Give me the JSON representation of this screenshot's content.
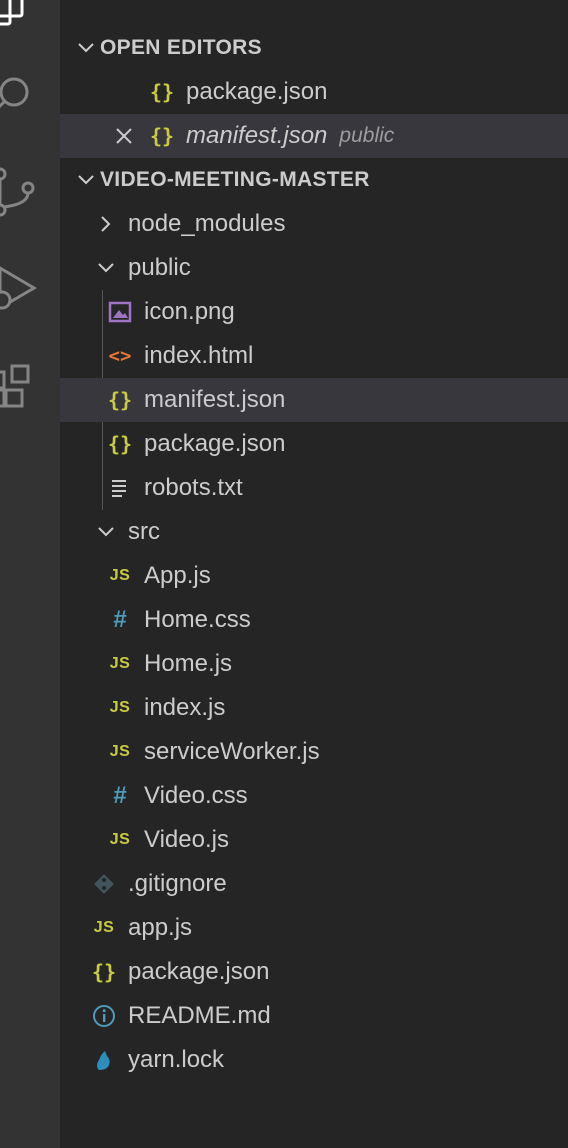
{
  "open_editors": {
    "header": "OPEN EDITORS",
    "items": [
      {
        "name": "package.json",
        "icon": "json-icon"
      },
      {
        "name": "manifest.json",
        "description": "public",
        "icon": "json-icon",
        "active": true
      }
    ]
  },
  "project": {
    "header": "VIDEO-MEETING-MASTER",
    "node_modules": "node_modules",
    "public": {
      "name": "public",
      "files": [
        "icon.png",
        "index.html",
        "manifest.json",
        "package.json",
        "robots.txt"
      ]
    },
    "src": {
      "name": "src",
      "files": [
        "App.js",
        "Home.css",
        "Home.js",
        "index.js",
        "serviceWorker.js",
        "Video.css",
        "Video.js"
      ]
    },
    "root_files": [
      ".gitignore",
      "app.js",
      "package.json",
      "README.md",
      "yarn.lock"
    ]
  },
  "colors": {
    "json": "#cbcb41",
    "js": "#cbcb41",
    "css": "#519aba",
    "html": "#e37933",
    "image": "#a074c4",
    "git": "#41535b",
    "info": "#519aba",
    "yarn": "#2c8ebb",
    "selected_row": "#37373d"
  },
  "icon_glyphs": {
    "json": "{}",
    "js": "JS",
    "css": "#",
    "html": "<>",
    "info": "i"
  }
}
